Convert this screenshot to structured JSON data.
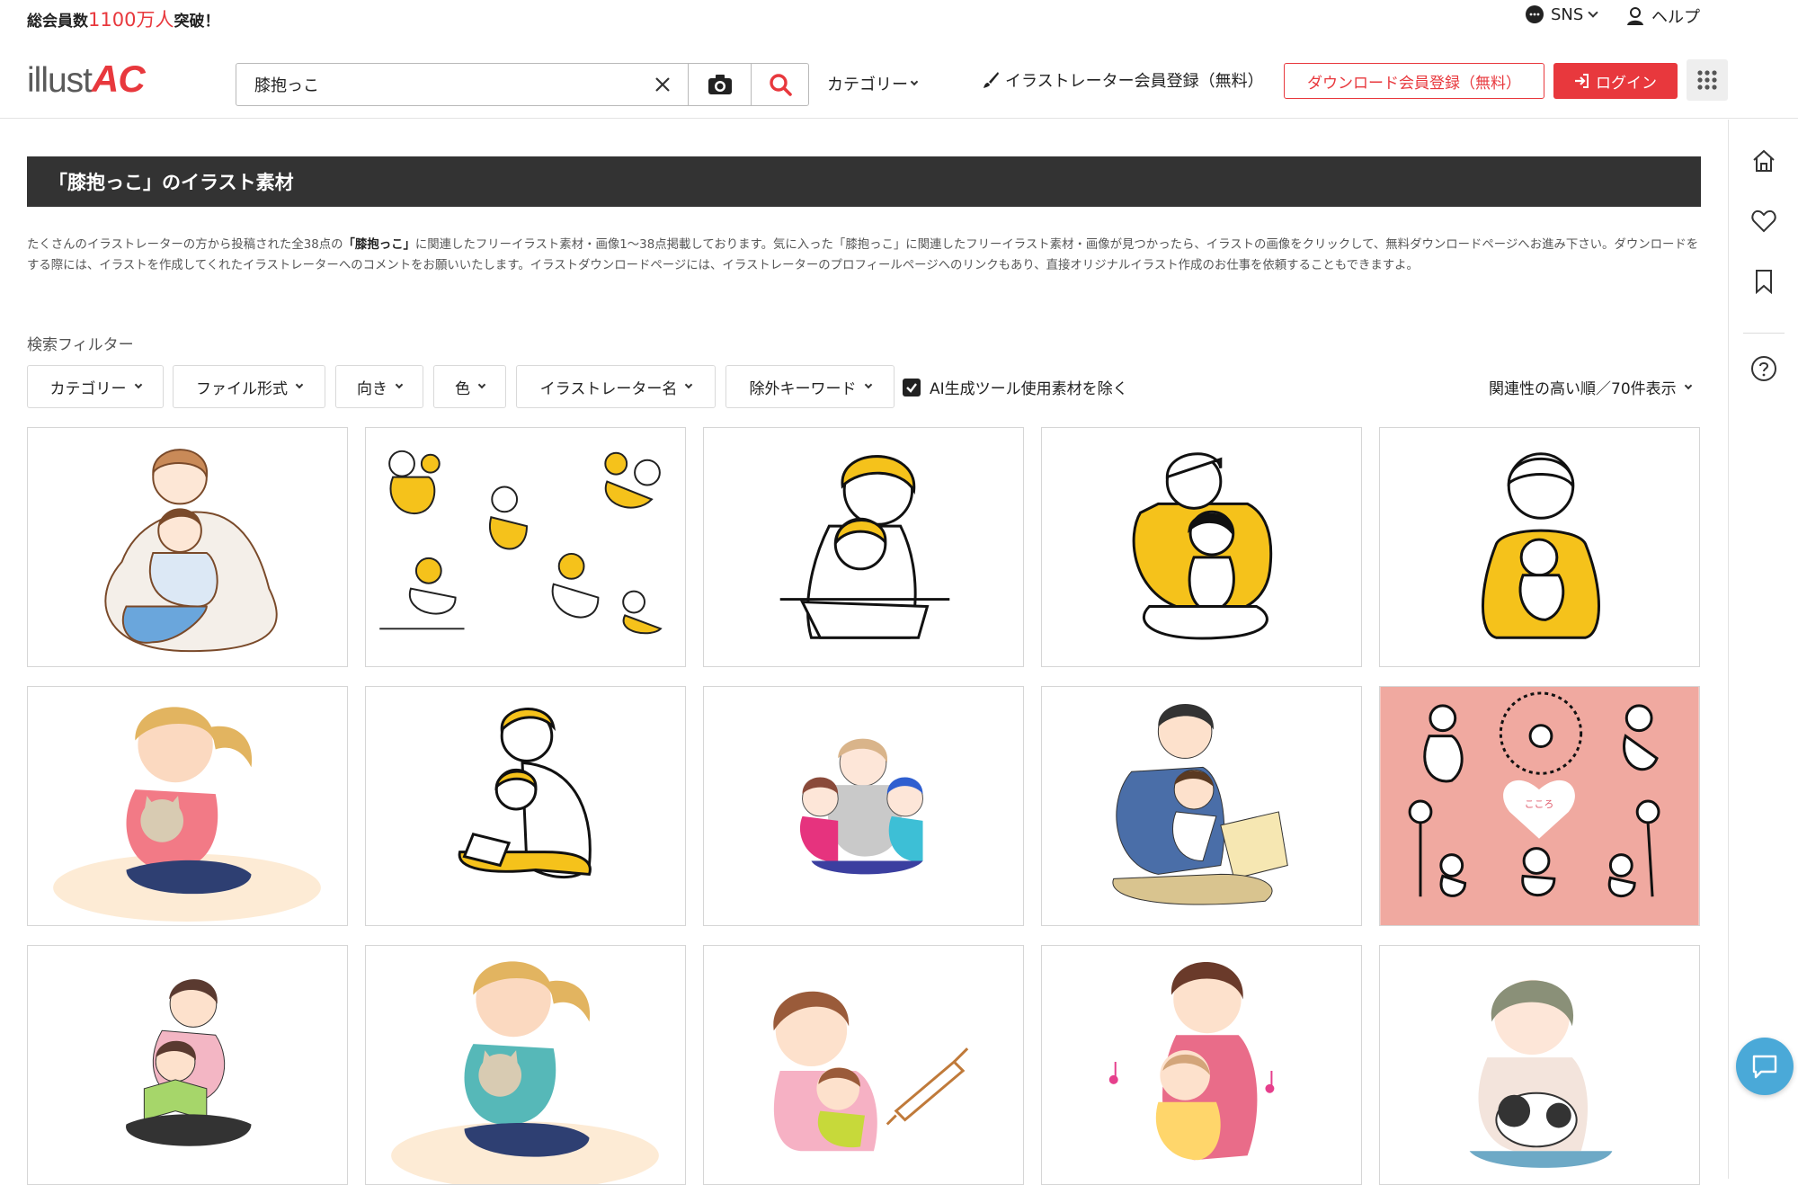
{
  "announce": {
    "prefix": "総会員数",
    "number": "1100万人",
    "suffix": "突破！"
  },
  "top_links": {
    "sns": "SNS",
    "help": "ヘルプ"
  },
  "logo": {
    "text_a": "illust",
    "text_b": "AC"
  },
  "search": {
    "value": "膝抱っこ"
  },
  "header": {
    "category": "カテゴリー",
    "illustrator_register": "イラストレーター会員登録（無料）",
    "download_register": "ダウンロード会員登録（無料）",
    "login": "ログイン"
  },
  "page": {
    "title": "「膝抱っこ」のイラスト素材",
    "desc_1": "たくさんのイラストレーターの方から投稿された全38点の",
    "desc_kw1": "「膝抱っこ」",
    "desc_2": "に関連したフリーイラスト素材・画像1〜38点掲載しております。気に入った「膝抱っこ」に関連したフリーイラスト素材・画像が見つかったら、イラストの画像をクリックして、無料ダウンロードページへお進み下さい。ダウンロードをする際には、イラストを作成してくれたイラストレーターへのコメントをお願いいたします。イラストダウンロードページには、イラストレーターのプロフィールページへのリンクもあり、直接オリジナルイラスト作成のお仕事を依頼することもできますよ。"
  },
  "filters": {
    "label": "検索フィルター",
    "category": "カテゴリー",
    "file_format": "ファイル形式",
    "orientation": "向き",
    "color": "色",
    "illustrator": "イラストレーター名",
    "exclude": "除外キーワード",
    "ai_exclude": "AI生成ツール使用素材を除く",
    "sort": "関連性の高い順／70件表示"
  },
  "colors": {
    "accent": "#e8383d",
    "titlebar": "#333333",
    "chat": "#4aa9d8",
    "yellow": "#f5c21b",
    "pink_bg": "#f0a9a0"
  },
  "icons": [
    "chat-bubble-icon",
    "person-help-icon",
    "close-icon",
    "camera-icon",
    "search-icon",
    "brush-icon",
    "login-icon",
    "grid-apps-icon",
    "home-icon",
    "heart-icon",
    "bookmark-icon",
    "question-icon",
    "checkbox-icon",
    "chevron-down-icon",
    "chat-icon"
  ],
  "thumbnails": [
    {
      "name": "mother-hugging-child-on-lap"
    },
    {
      "name": "parent-child-set-yellow"
    },
    {
      "name": "mother-child-drawing-yellow"
    },
    {
      "name": "father-child-yellow-sweater"
    },
    {
      "name": "mother-holding-baby-yellow"
    },
    {
      "name": "girl-holding-cat"
    },
    {
      "name": "father-child-reading-yellow"
    },
    {
      "name": "mother-with-two-children"
    },
    {
      "name": "father-child-picture-book"
    },
    {
      "name": "hugging-figures-pink"
    },
    {
      "name": "mother-daughter-reading"
    },
    {
      "name": "girl-holding-cat-teal"
    },
    {
      "name": "mother-child-injection"
    },
    {
      "name": "mother-baby-music"
    },
    {
      "name": "girl-holding-cat-gray-hair"
    }
  ]
}
